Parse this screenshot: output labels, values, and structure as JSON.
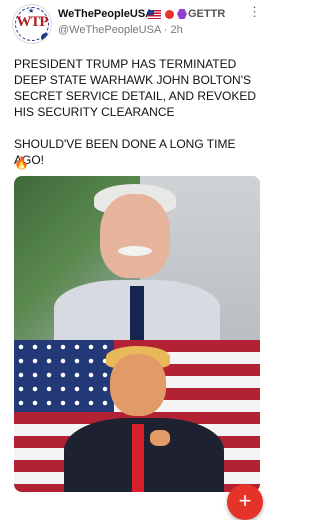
{
  "post": {
    "avatar_text": "WTP",
    "display_name": "WeThePeopleUSA",
    "platform_label": "GETTR",
    "handle": "@WeThePeopleUSA",
    "time": "· 2h",
    "text": "PRESIDENT TRUMP HAS TERMINATED DEEP STATE WARHAWK JOHN BOLTON'S SECRET SERVICE DETAIL, AND REVOKED HIS SECURITY CLEARANCE\n\nSHOULD'VE BEEN DONE A LONG TIME AGO!",
    "emoji": "🔥"
  },
  "icons": {
    "more": "more-options-icon",
    "flag": "us-flag-icon",
    "verified": "verified-badge-icon",
    "gettr": "gettr-logo-icon",
    "compose": "plus-icon"
  },
  "fab": {
    "label": "+"
  },
  "colors": {
    "accent": "#e5332a",
    "text": "#111111",
    "muted": "#777777"
  }
}
